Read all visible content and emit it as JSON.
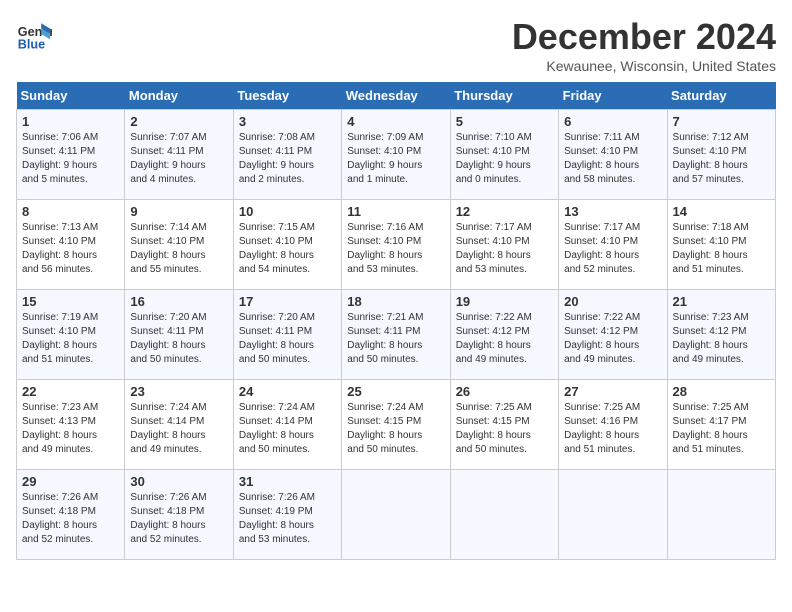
{
  "logo": {
    "general": "General",
    "blue": "Blue"
  },
  "title": "December 2024",
  "subtitle": "Kewaunee, Wisconsin, United States",
  "days_of_week": [
    "Sunday",
    "Monday",
    "Tuesday",
    "Wednesday",
    "Thursday",
    "Friday",
    "Saturday"
  ],
  "weeks": [
    [
      {
        "day": "1",
        "info": "Sunrise: 7:06 AM\nSunset: 4:11 PM\nDaylight: 9 hours\nand 5 minutes."
      },
      {
        "day": "2",
        "info": "Sunrise: 7:07 AM\nSunset: 4:11 PM\nDaylight: 9 hours\nand 4 minutes."
      },
      {
        "day": "3",
        "info": "Sunrise: 7:08 AM\nSunset: 4:11 PM\nDaylight: 9 hours\nand 2 minutes."
      },
      {
        "day": "4",
        "info": "Sunrise: 7:09 AM\nSunset: 4:10 PM\nDaylight: 9 hours\nand 1 minute."
      },
      {
        "day": "5",
        "info": "Sunrise: 7:10 AM\nSunset: 4:10 PM\nDaylight: 9 hours\nand 0 minutes."
      },
      {
        "day": "6",
        "info": "Sunrise: 7:11 AM\nSunset: 4:10 PM\nDaylight: 8 hours\nand 58 minutes."
      },
      {
        "day": "7",
        "info": "Sunrise: 7:12 AM\nSunset: 4:10 PM\nDaylight: 8 hours\nand 57 minutes."
      }
    ],
    [
      {
        "day": "8",
        "info": "Sunrise: 7:13 AM\nSunset: 4:10 PM\nDaylight: 8 hours\nand 56 minutes."
      },
      {
        "day": "9",
        "info": "Sunrise: 7:14 AM\nSunset: 4:10 PM\nDaylight: 8 hours\nand 55 minutes."
      },
      {
        "day": "10",
        "info": "Sunrise: 7:15 AM\nSunset: 4:10 PM\nDaylight: 8 hours\nand 54 minutes."
      },
      {
        "day": "11",
        "info": "Sunrise: 7:16 AM\nSunset: 4:10 PM\nDaylight: 8 hours\nand 53 minutes."
      },
      {
        "day": "12",
        "info": "Sunrise: 7:17 AM\nSunset: 4:10 PM\nDaylight: 8 hours\nand 53 minutes."
      },
      {
        "day": "13",
        "info": "Sunrise: 7:17 AM\nSunset: 4:10 PM\nDaylight: 8 hours\nand 52 minutes."
      },
      {
        "day": "14",
        "info": "Sunrise: 7:18 AM\nSunset: 4:10 PM\nDaylight: 8 hours\nand 51 minutes."
      }
    ],
    [
      {
        "day": "15",
        "info": "Sunrise: 7:19 AM\nSunset: 4:10 PM\nDaylight: 8 hours\nand 51 minutes."
      },
      {
        "day": "16",
        "info": "Sunrise: 7:20 AM\nSunset: 4:11 PM\nDaylight: 8 hours\nand 50 minutes."
      },
      {
        "day": "17",
        "info": "Sunrise: 7:20 AM\nSunset: 4:11 PM\nDaylight: 8 hours\nand 50 minutes."
      },
      {
        "day": "18",
        "info": "Sunrise: 7:21 AM\nSunset: 4:11 PM\nDaylight: 8 hours\nand 50 minutes."
      },
      {
        "day": "19",
        "info": "Sunrise: 7:22 AM\nSunset: 4:12 PM\nDaylight: 8 hours\nand 49 minutes."
      },
      {
        "day": "20",
        "info": "Sunrise: 7:22 AM\nSunset: 4:12 PM\nDaylight: 8 hours\nand 49 minutes."
      },
      {
        "day": "21",
        "info": "Sunrise: 7:23 AM\nSunset: 4:12 PM\nDaylight: 8 hours\nand 49 minutes."
      }
    ],
    [
      {
        "day": "22",
        "info": "Sunrise: 7:23 AM\nSunset: 4:13 PM\nDaylight: 8 hours\nand 49 minutes."
      },
      {
        "day": "23",
        "info": "Sunrise: 7:24 AM\nSunset: 4:14 PM\nDaylight: 8 hours\nand 49 minutes."
      },
      {
        "day": "24",
        "info": "Sunrise: 7:24 AM\nSunset: 4:14 PM\nDaylight: 8 hours\nand 50 minutes."
      },
      {
        "day": "25",
        "info": "Sunrise: 7:24 AM\nSunset: 4:15 PM\nDaylight: 8 hours\nand 50 minutes."
      },
      {
        "day": "26",
        "info": "Sunrise: 7:25 AM\nSunset: 4:15 PM\nDaylight: 8 hours\nand 50 minutes."
      },
      {
        "day": "27",
        "info": "Sunrise: 7:25 AM\nSunset: 4:16 PM\nDaylight: 8 hours\nand 51 minutes."
      },
      {
        "day": "28",
        "info": "Sunrise: 7:25 AM\nSunset: 4:17 PM\nDaylight: 8 hours\nand 51 minutes."
      }
    ],
    [
      {
        "day": "29",
        "info": "Sunrise: 7:26 AM\nSunset: 4:18 PM\nDaylight: 8 hours\nand 52 minutes."
      },
      {
        "day": "30",
        "info": "Sunrise: 7:26 AM\nSunset: 4:18 PM\nDaylight: 8 hours\nand 52 minutes."
      },
      {
        "day": "31",
        "info": "Sunrise: 7:26 AM\nSunset: 4:19 PM\nDaylight: 8 hours\nand 53 minutes."
      },
      {
        "day": "",
        "info": ""
      },
      {
        "day": "",
        "info": ""
      },
      {
        "day": "",
        "info": ""
      },
      {
        "day": "",
        "info": ""
      }
    ]
  ]
}
